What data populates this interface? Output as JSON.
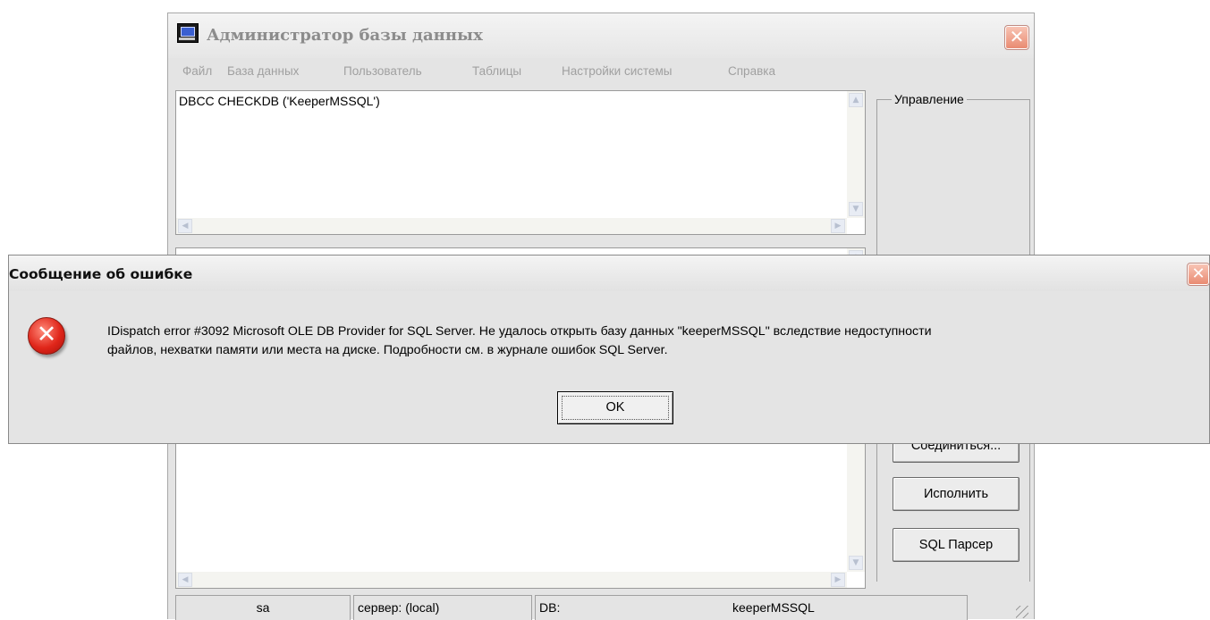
{
  "main_window": {
    "title": "Администратор базы данных",
    "close_glyph": "✕",
    "menu": [
      "Файл",
      "База данных",
      "Пользователь",
      "Таблицы",
      "Настройки системы",
      "Справка"
    ],
    "query_text": "DBCC CHECKDB ('KeeperMSSQL')",
    "result_text": "",
    "controls_group_label": "Управление",
    "buttons": {
      "connect_partial": "Соединиться...",
      "execute": "Исполнить",
      "sql_parser": "SQL Парсер"
    },
    "status": {
      "user": "sa",
      "server": "сервер: (local)",
      "db_label": "DB:",
      "db_name": "keeperMSSQL"
    }
  },
  "error_dialog": {
    "title": "Сообщение об ошибке",
    "icon": "error-icon",
    "close_glyph": "✕",
    "message_line1": "IDispatch error #3092 Microsoft OLE DB Provider for SQL Server. Не удалось открыть базу данных \"keeperMSSQL\" вследствие недоступности",
    "message_line2": "файлов, нехватки памяти или места на диске. Подробности см. в журнале ошибок SQL Server.",
    "ok_label": "OK"
  },
  "colors": {
    "window_bg": "#e4e4e4",
    "close_button": "#e98b72",
    "error_icon": "#e0261a",
    "menu_text_disabled": "#a0a0a0"
  }
}
